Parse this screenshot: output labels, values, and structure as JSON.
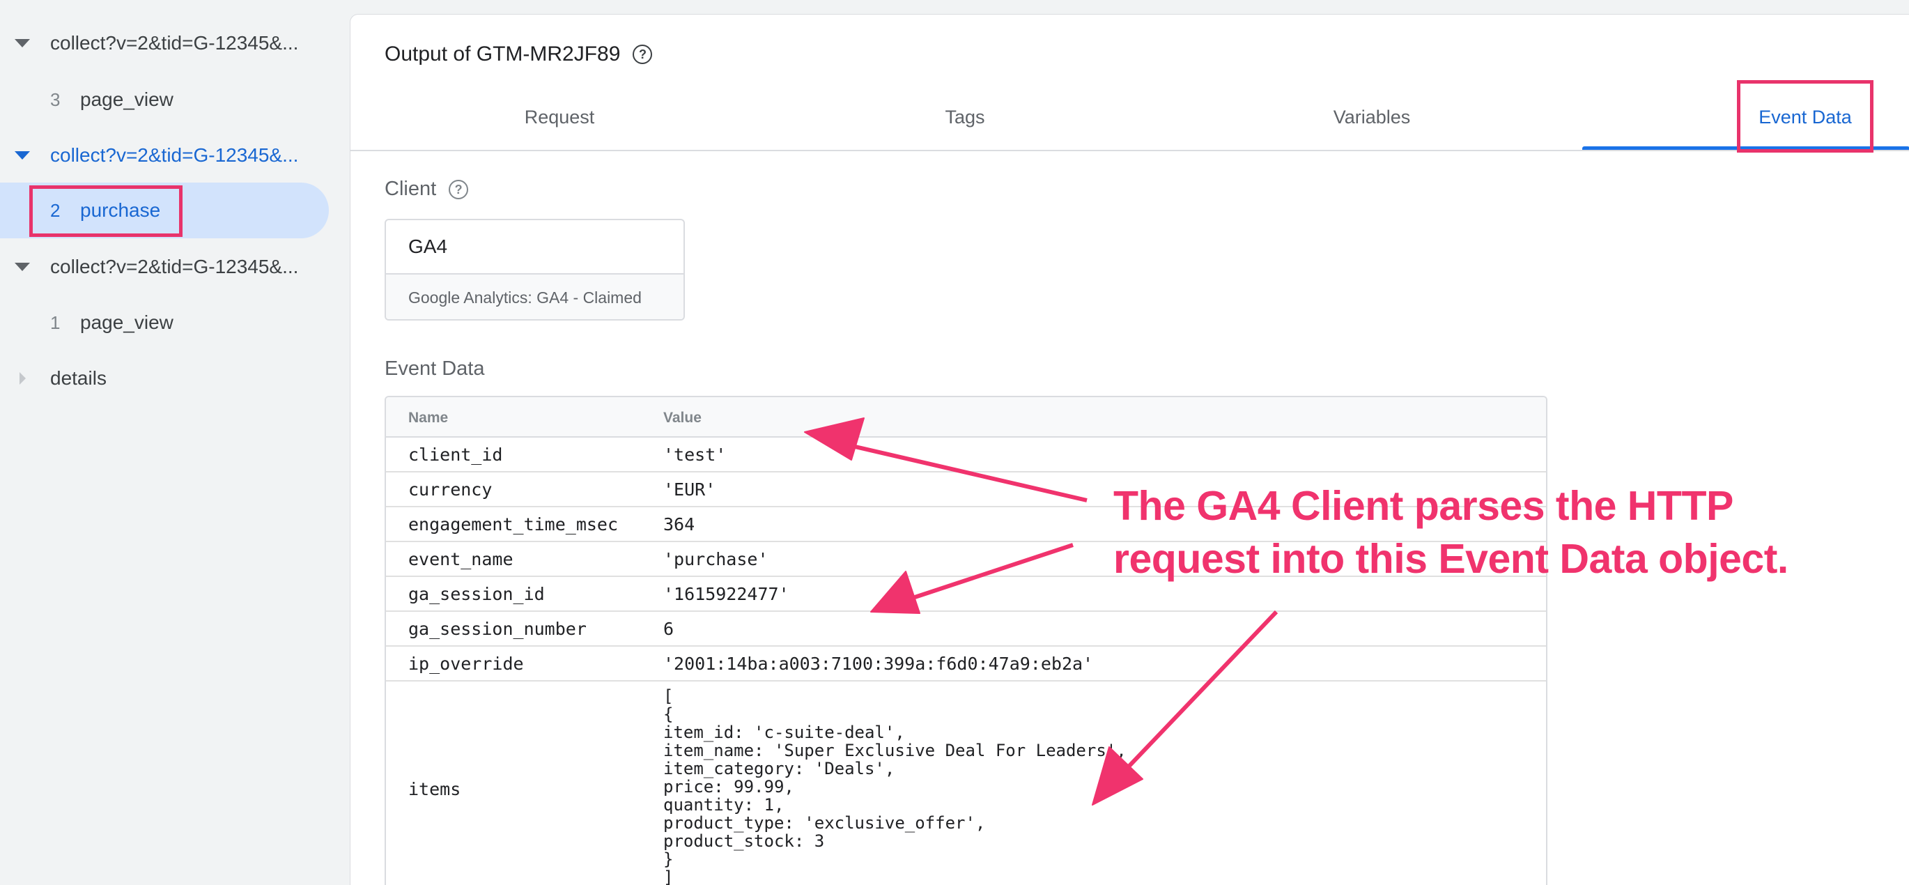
{
  "sidebar": {
    "groups": [
      {
        "label": "collect?v=2&tid=G-12345&...",
        "child_num": "3",
        "child_label": "page_view"
      },
      {
        "label": "collect?v=2&tid=G-12345&...",
        "child_num": "2",
        "child_label": "purchase"
      },
      {
        "label": "collect?v=2&tid=G-12345&...",
        "child_num": "1",
        "child_label": "page_view"
      }
    ],
    "details_label": "details"
  },
  "header": {
    "title": "Output of GTM-MR2JF89"
  },
  "tabs": [
    {
      "label": "Request"
    },
    {
      "label": "Tags"
    },
    {
      "label": "Variables"
    },
    {
      "label": "Event Data"
    }
  ],
  "client": {
    "section_label": "Client",
    "name": "GA4",
    "status": "Google Analytics: GA4 - Claimed"
  },
  "event_data": {
    "section_label": "Event Data",
    "columns": [
      "Name",
      "Value"
    ],
    "rows": [
      {
        "name": "client_id",
        "value": "'test'"
      },
      {
        "name": "currency",
        "value": "'EUR'"
      },
      {
        "name": "engagement_time_msec",
        "value": "364"
      },
      {
        "name": "event_name",
        "value": "'purchase'"
      },
      {
        "name": "ga_session_id",
        "value": "'1615922477'"
      },
      {
        "name": "ga_session_number",
        "value": "6"
      },
      {
        "name": "ip_override",
        "value": "'2001:14ba:a003:7100:399a:f6d0:47a9:eb2a'"
      }
    ],
    "items_row": {
      "name": "items",
      "value": "[\n{\nitem_id: 'c-suite-deal',\nitem_name: 'Super Exclusive Deal For Leaders',\nitem_category: 'Deals',\nprice: 99.99,\nquantity: 1,\nproduct_type: 'exclusive_offer',\nproduct_stock: 3\n}\n]"
    }
  },
  "annotation": {
    "line1": "The GA4 Client parses the HTTP",
    "line2": "request into this Event Data object.",
    "color": "#f0336d"
  },
  "colors": {
    "accent": "#1967d2",
    "highlight": "#e8336b",
    "selected_bg": "#d2e3fc"
  }
}
